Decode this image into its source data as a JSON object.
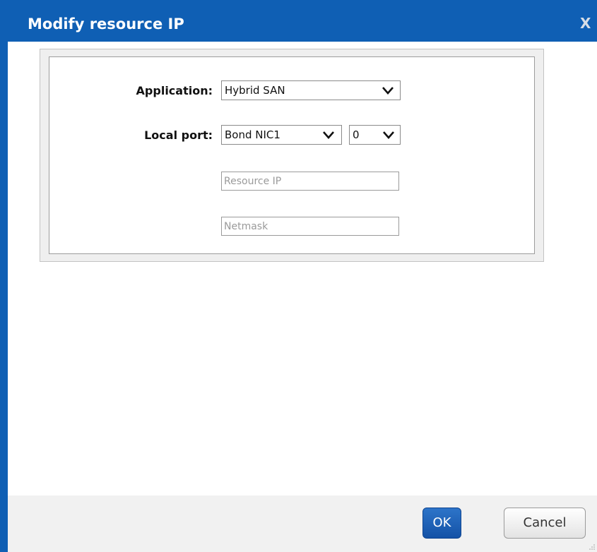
{
  "dialog": {
    "title": "Modify resource IP",
    "close_glyph": "X"
  },
  "form": {
    "application": {
      "label": "Application:",
      "selected": "Hybrid SAN"
    },
    "local_port": {
      "label": "Local port:",
      "interface_selected": "Bond NIC1",
      "index_selected": "0"
    },
    "resource_ip": {
      "value": "",
      "placeholder": "Resource IP"
    },
    "netmask": {
      "value": "",
      "placeholder": "Netmask"
    }
  },
  "footer": {
    "ok_label": "OK",
    "cancel_label": "Cancel"
  },
  "icons": {
    "select_chevron": "chevron-down-icon",
    "close": "close-icon",
    "resize": "resize-grip-icon"
  },
  "colors": {
    "titlebar": "#0f5fb4",
    "ok_button": "#1a5fb4",
    "footer": "#f1f1f1"
  }
}
